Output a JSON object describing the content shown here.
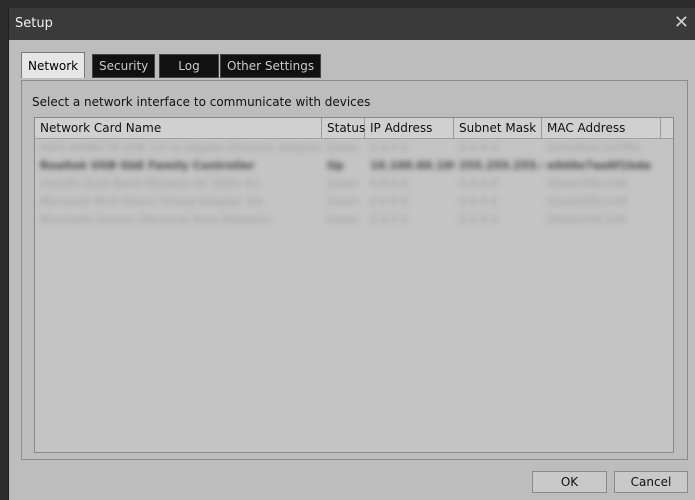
{
  "window": {
    "title": "Setup",
    "close_glyph": "✕"
  },
  "tabs": [
    {
      "label": "Network",
      "active": true
    },
    {
      "label": "Security",
      "active": false
    },
    {
      "label": "Log",
      "active": false
    },
    {
      "label": "Other Settings",
      "active": false
    }
  ],
  "network": {
    "caption": "Select a network interface to communicate with devices",
    "columns": [
      "Network Card Name",
      "Status",
      "IP Address",
      "Subnet Mask",
      "MAC Address"
    ],
    "rows": [
      {
        "name": "ASIX AX88179 USB 3.0 to Gigabit Ethernet Adapter",
        "status": "Down",
        "ip": "0.0.0.0",
        "subnet": "0.0.0.0",
        "mac": "0x5a3b2c1d7f8e"
      },
      {
        "name": "Realtek USB GbE Family Controller",
        "status": "Up",
        "ip": "10.100.60.100",
        "subnet": "255.255.255.0",
        "mac": "e0d4e7aa6f1bda"
      },
      {
        "name": "Intel(R) Dual Band Wireless-AC 8265 #2",
        "status": "Down",
        "ip": "0.0.0.0",
        "subnet": "0.0.0.0",
        "mac": "00a4e5f6c1d8"
      },
      {
        "name": "Microsoft Wi-Fi Direct Virtual Adapter #4",
        "status": "Down",
        "ip": "0.0.0.0",
        "subnet": "0.0.0.0",
        "mac": "02a4e5f6c1d8"
      },
      {
        "name": "Bluetooth Device (Personal Area Network)",
        "status": "Down",
        "ip": "0.0.0.0",
        "subnet": "0.0.0.0",
        "mac": "00a4e5f6c1d9"
      }
    ]
  },
  "buttons": {
    "ok": "OK",
    "cancel": "Cancel"
  }
}
